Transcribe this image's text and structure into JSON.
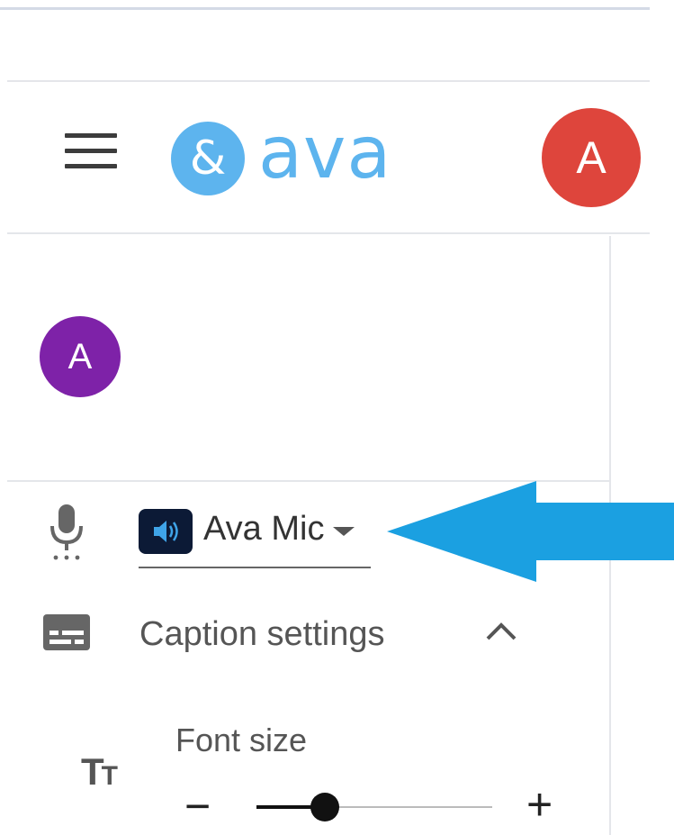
{
  "header": {
    "logo_symbol": "&",
    "logo_text": "ava",
    "user_avatar_initial": "A",
    "menu_icon": "hamburger-menu-icon"
  },
  "participant": {
    "avatar_initial": "A"
  },
  "mic": {
    "icon": "microphone-icon",
    "source_icon": "speaker-icon",
    "selected_label": "Ava Mic"
  },
  "captions": {
    "icon": "closed-caption-icon",
    "label": "Caption settings",
    "expanded": true
  },
  "font_size": {
    "icon": "text-size-icon",
    "icon_text": "T",
    "icon_text_small": "T",
    "label": "Font size",
    "minus_label": "−",
    "plus_label": "+",
    "level": 0.29
  },
  "colors": {
    "brand": "#5db4ee",
    "user_avatar": "#de453c",
    "participant_avatar": "#7e22a8",
    "annotation_arrow": "#1ba0e1"
  }
}
